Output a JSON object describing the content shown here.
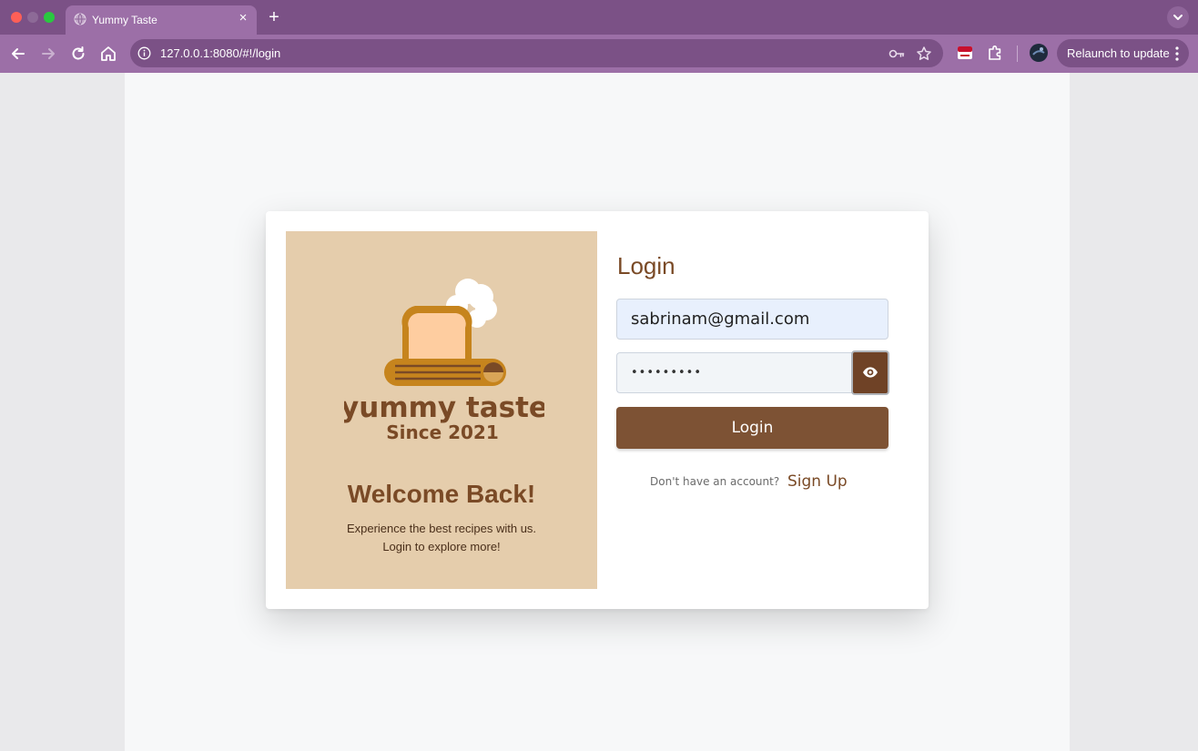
{
  "browser": {
    "tab_title": "Yummy Taste",
    "tab_close_glyph": "×",
    "new_tab_glyph": "+",
    "url": "127.0.0.1:8080/#!/login",
    "relaunch_label": "Relaunch to update"
  },
  "brand": {
    "logo_line1": "yummy taste",
    "logo_line2": "Since 2021",
    "welcome": "Welcome Back!",
    "tagline_line1": "Experience the best recipes with us.",
    "tagline_line2": "Login to explore more!"
  },
  "login": {
    "title": "Login",
    "email_value": "sabrinam@gmail.com",
    "password_value": "•••••••••",
    "submit_label": "Login",
    "no_account_text": "Don't have an account?",
    "signup_label": "Sign Up"
  },
  "colors": {
    "chrome_dark": "#7b5186",
    "chrome_light": "#9c6fa7",
    "panel_tan": "#e5cdac",
    "brown": "#7d5234",
    "brown_dark": "#6f4226",
    "input_blue": "#e8f0fd"
  },
  "icons": {
    "favicon": "globe-icon",
    "back": "arrow-left-icon",
    "forward": "arrow-right-icon",
    "reload": "reload-icon",
    "home": "home-icon",
    "site_info": "info-icon",
    "password_manager": "key-icon",
    "bookmark": "star-icon",
    "extension_pdf": "pdf-extension-icon",
    "extensions": "puzzle-icon",
    "profile": "avatar-icon",
    "menu": "vertical-dots-icon",
    "tab_search": "chevron-down-icon",
    "show_password": "eye-icon"
  }
}
